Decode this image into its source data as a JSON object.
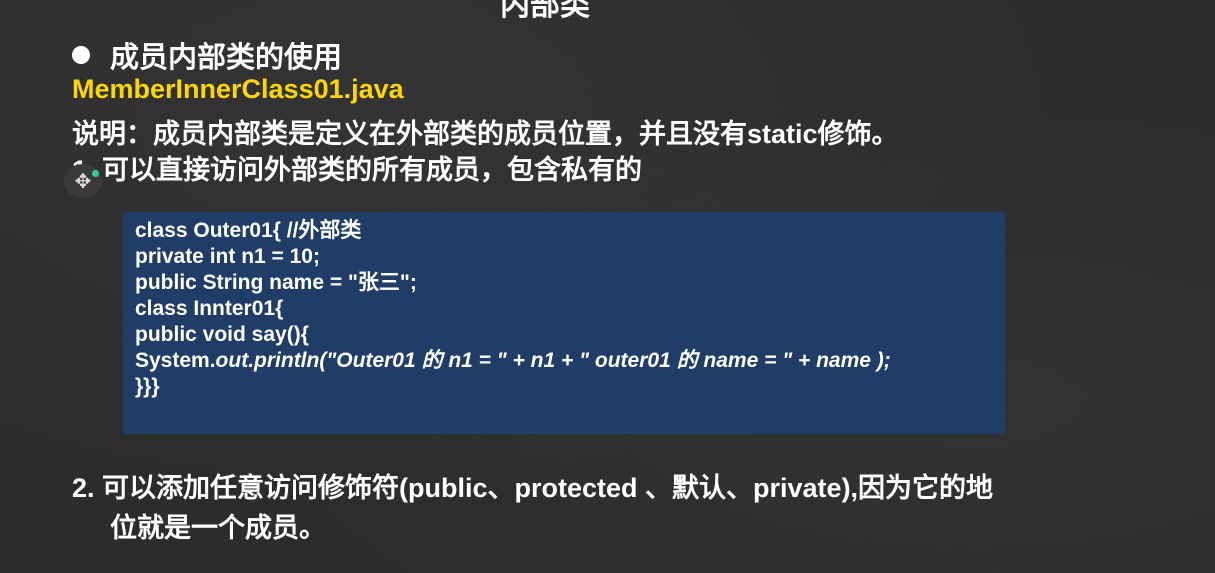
{
  "slide": {
    "top_title_clip": "内部类",
    "heading": "成员内部类的使用",
    "filename": "MemberInnerClass01.java",
    "explain": "说明：成员内部类是定义在外部类的成员位置，并且没有static修饰。",
    "point1": "1. 可以直接访问外部类的所有成员，包含私有的",
    "point2_line1": "2. 可以添加任意访问修饰符(public、protected 、默认、private),因为它的地",
    "point2_line2": "位就是一个成员。"
  },
  "code": {
    "line1": "class Outer01{ //外部类",
    "line2": "private int n1 = 10;",
    "line3": "public String name = \"张三\";",
    "line4": "class Innter01{",
    "line5": "public void say(){",
    "line6_prefix": "System.",
    "line6_italic": "out.println(\"Outer01 的 n1 = \" + n1 + \" outer01 的 name = \" + name );",
    "line7": "}}}"
  },
  "colors": {
    "background": "#2b2b2b",
    "filename": "#ffd700",
    "code_box": "#1f3d66",
    "cursor_dot": "#2ecc9a"
  },
  "icons": {
    "bullet": "bullet-dot",
    "cursor": "move-cursor-icon"
  }
}
